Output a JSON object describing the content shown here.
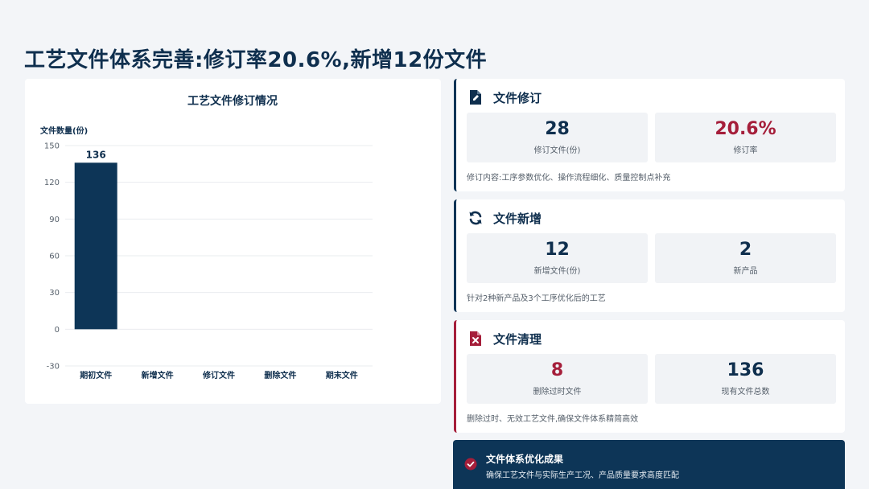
{
  "page": {
    "title": "工艺文件体系完善:修订率20.6%,新增12份文件"
  },
  "chart_data": {
    "type": "bar",
    "title": "工艺文件修订情况",
    "ylabel": "文件数量(份)",
    "xlabel": "",
    "categories": [
      "期初文件",
      "新增文件",
      "修订文件",
      "删除文件",
      "期末文件"
    ],
    "values": [
      136,
      0,
      0,
      0,
      0
    ],
    "value_labels": [
      "136",
      "",
      "",
      "",
      ""
    ],
    "ylim": [
      -30,
      150
    ],
    "yticks": [
      -30,
      0,
      30,
      60,
      90,
      120,
      150
    ],
    "grid": true,
    "legend": "none",
    "bar_color": "#0d3557"
  },
  "cards": {
    "revision": {
      "title": "文件修订",
      "icon": "file-edit-icon",
      "stat1_value": "28",
      "stat1_label": "修订文件(份)",
      "stat2_value": "20.6%",
      "stat2_label": "修订率",
      "note": "修订内容:工序参数优化、操作流程细化、质量控制点补充"
    },
    "addition": {
      "title": "文件新增",
      "icon": "refresh-icon",
      "stat1_value": "12",
      "stat1_label": "新增文件(份)",
      "stat2_value": "2",
      "stat2_label": "新产品",
      "note": "针对2种新产品及3个工序优化后的工艺"
    },
    "cleanup": {
      "title": "文件清理",
      "icon": "file-delete-icon",
      "stat1_value": "8",
      "stat1_label": "删除过时文件",
      "stat2_value": "136",
      "stat2_label": "现有文件总数",
      "note": "删除过时、无效工艺文件,确保文件体系精简高效"
    }
  },
  "banner": {
    "title": "文件体系优化成果",
    "desc": "确保工艺文件与实际生产工况、产品质量要求高度匹配",
    "icon": "check-circle-icon"
  },
  "colors": {
    "navy": "#0d3557",
    "accent_red": "#a51e3a",
    "background": "#f3f5f8"
  }
}
